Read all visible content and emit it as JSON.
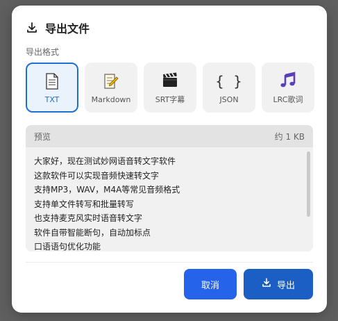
{
  "dialog": {
    "title": "导出文件",
    "format_label": "导出格式",
    "formats": [
      {
        "label": "TXT",
        "icon": "document-icon",
        "selected": true
      },
      {
        "label": "Markdown",
        "icon": "memo-icon",
        "selected": false
      },
      {
        "label": "SRT字幕",
        "icon": "clapperboard-icon",
        "selected": false
      },
      {
        "label": "JSON",
        "icon": "braces-icon",
        "glyph": "{ }",
        "selected": false
      },
      {
        "label": "LRC歌词",
        "icon": "music-notes-icon",
        "selected": false
      }
    ],
    "preview": {
      "label": "预览",
      "size": "约 1 KB",
      "lines": [
        "大家好，现在测试妙网语音转文字软件",
        "这款软件可以实现音频快速转文字",
        "支持MP3，WAV，M4A等常见音频格式",
        "支持单文件转写和批量转写",
        "也支持麦克风实时语音转文字",
        "软件自带智能断句，自动加标点",
        "口语语句优化功能"
      ]
    },
    "buttons": {
      "cancel": "取消",
      "export": "导出"
    }
  },
  "colors": {
    "accent": "#1f6fd1",
    "cancel_bg": "#2563eb",
    "export_bg": "#1b5fc5",
    "overlay": "#5f5f5f"
  }
}
